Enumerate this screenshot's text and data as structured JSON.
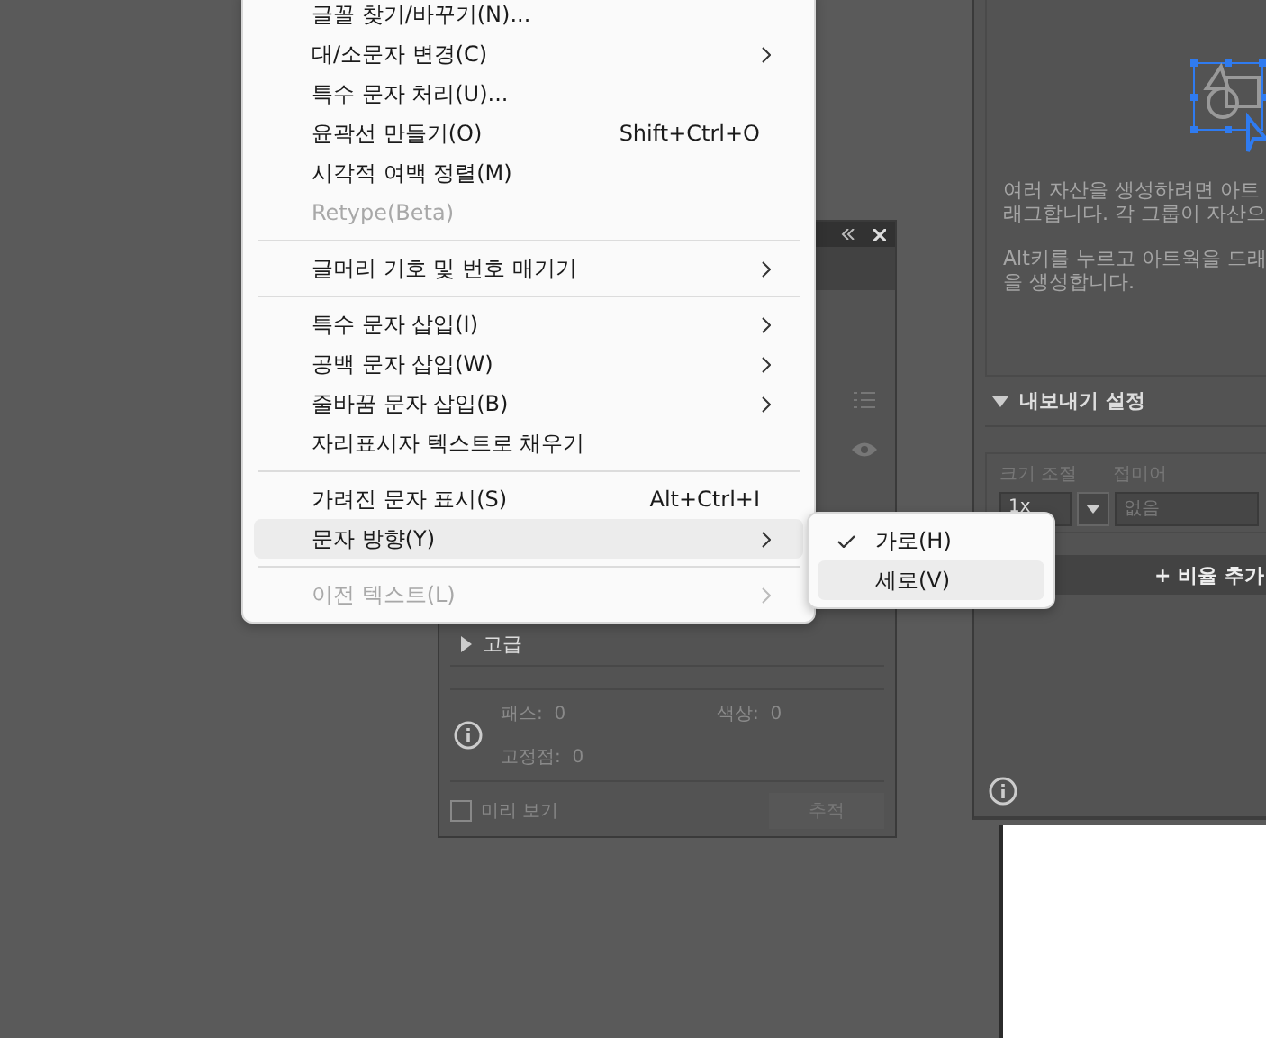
{
  "menu": {
    "items": [
      {
        "kind": "item",
        "label": "글꼴 찾기/바꾸기(N)...",
        "disabled": false,
        "submenu": false,
        "selected": false
      },
      {
        "kind": "item",
        "label": "대/소문자 변경(C)",
        "disabled": false,
        "submenu": true,
        "selected": false
      },
      {
        "kind": "item",
        "label": "특수 문자 처리(U)...",
        "disabled": false,
        "submenu": false,
        "selected": false
      },
      {
        "kind": "item",
        "label": "윤곽선 만들기(O)",
        "shortcut": "Shift+Ctrl+O",
        "disabled": false,
        "submenu": false,
        "selected": false
      },
      {
        "kind": "item",
        "label": "시각적 여백 정렬(M)",
        "disabled": false,
        "submenu": false,
        "selected": false
      },
      {
        "kind": "item",
        "label": "Retype(Beta)",
        "disabled": true,
        "submenu": false,
        "selected": false
      },
      {
        "kind": "separator"
      },
      {
        "kind": "item",
        "label": "글머리 기호 및 번호 매기기",
        "disabled": false,
        "submenu": true,
        "selected": false
      },
      {
        "kind": "separator"
      },
      {
        "kind": "item",
        "label": "특수 문자 삽입(I)",
        "disabled": false,
        "submenu": true,
        "selected": false
      },
      {
        "kind": "item",
        "label": "공백 문자 삽입(W)",
        "disabled": false,
        "submenu": true,
        "selected": false
      },
      {
        "kind": "item",
        "label": "줄바꿈 문자 삽입(B)",
        "disabled": false,
        "submenu": true,
        "selected": false
      },
      {
        "kind": "item",
        "label": "자리표시자 텍스트로 채우기",
        "disabled": false,
        "submenu": false,
        "selected": false
      },
      {
        "kind": "separator"
      },
      {
        "kind": "item",
        "label": "가려진 문자 표시(S)",
        "shortcut": "Alt+Ctrl+I",
        "disabled": false,
        "submenu": false,
        "selected": false
      },
      {
        "kind": "item",
        "label": "문자 방향(Y)",
        "disabled": false,
        "submenu": true,
        "selected": true
      },
      {
        "kind": "separator"
      },
      {
        "kind": "item",
        "label": "이전 텍스트(L)",
        "disabled": true,
        "submenu": true,
        "selected": false
      }
    ]
  },
  "submenu": {
    "items": [
      {
        "label": "가로(H)",
        "checked": true,
        "selected": false
      },
      {
        "label": "세로(V)",
        "checked": false,
        "selected": true
      }
    ]
  },
  "trace_panel": {
    "advanced": {
      "label": "고급",
      "expanded": false
    },
    "stats": [
      {
        "label": "패스:",
        "value": "0"
      },
      {
        "label": "색상:",
        "value": "0"
      },
      {
        "label": "고정점:",
        "value": "0"
      }
    ],
    "preview": {
      "label": "미리 보기",
      "checked": false
    },
    "trace_button": {
      "label": "추적",
      "disabled": true
    }
  },
  "asset_panel": {
    "hint_lines": [
      "여러 자산을 생성하려면 아트",
      "래그합니다. 각 그룹이 자산으"
    ],
    "hint2_lines": [
      "Alt키를 누르고 아트웍을 드래",
      "을 생성합니다."
    ],
    "export_settings": {
      "label": "내보내기 설정",
      "expanded": true
    },
    "columns": [
      "크기 조절",
      "접미어"
    ],
    "scale": "1x",
    "suffix_placeholder": "없음",
    "add_button": "+ 비율 추가"
  }
}
